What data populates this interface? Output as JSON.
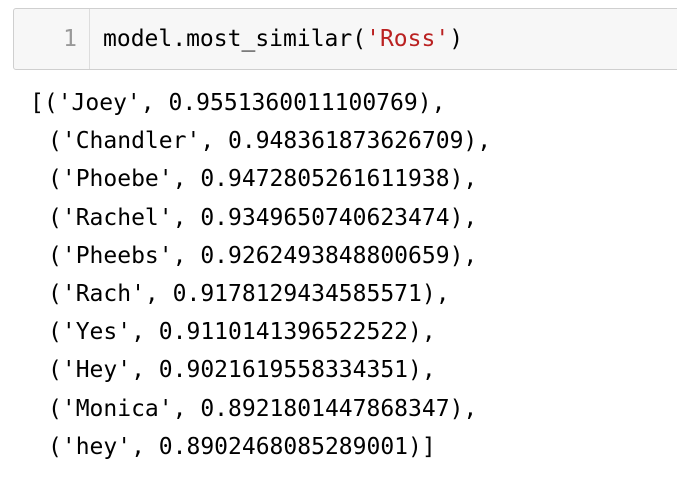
{
  "input_cell": {
    "line_number": "1",
    "code_prefix": "model.most_similar(",
    "code_string": "'Ross'",
    "code_suffix": ")"
  },
  "output": {
    "lines": [
      "[('Joey', 0.9551360011100769),",
      "('Chandler', 0.948361873626709),",
      "('Phoebe', 0.9472805261611938),",
      "('Rachel', 0.9349650740623474),",
      "('Pheebs', 0.9262493848800659),",
      "('Rach', 0.9178129434585571),",
      "('Yes', 0.9110141396522522),",
      "('Hey', 0.9021619558334351),",
      "('Monica', 0.8921801447868347),",
      "('hey', 0.8902468085289001)]"
    ]
  },
  "colors": {
    "string": "#ba2121",
    "cell_background": "#f7f7f7",
    "line_number": "#999999"
  }
}
